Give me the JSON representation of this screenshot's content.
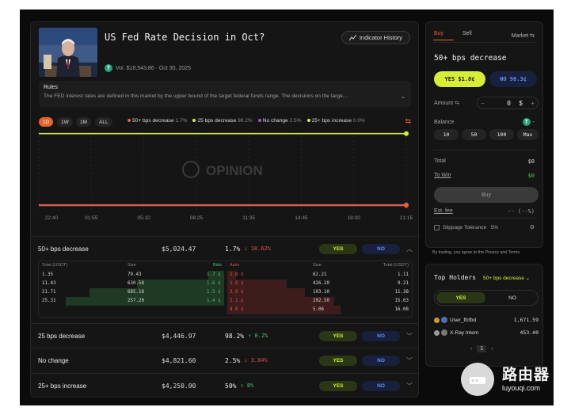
{
  "market": {
    "title": "US Fed Rate Decision in Oct?",
    "indicator_history_label": "Indicator History",
    "volume": "Vol. $18,543.86 · Oct 30, 2025",
    "rules_title": "Rules",
    "rules_text": "The FED interest rates are defined in this market by the upper bound of the target federal funds range. The decisions on the targe..."
  },
  "timeframes": [
    "1D",
    "1W",
    "1M",
    "ALL"
  ],
  "active_timeframe": "1D",
  "legend": [
    {
      "name": "50+ bps decrease",
      "pct": "1.7%",
      "color": "#e8622a"
    },
    {
      "name": "25 bps decrease",
      "pct": "98.2%",
      "color": "#d7ee36"
    },
    {
      "name": "No change",
      "pct": "2.5%",
      "color": "#9b59d0"
    },
    {
      "name": "25+ bps increase",
      "pct": "0.0%",
      "color": "#d7ee36"
    }
  ],
  "chart_data": {
    "type": "line",
    "x": [
      "22:40",
      "01:55",
      "05:10",
      "08:25",
      "11:35",
      "14:45",
      "18:00",
      "21:15"
    ],
    "series": [
      {
        "name": "25 bps decrease",
        "values": [
          98.2,
          98.2,
          98.2,
          98.2,
          98.2,
          98.2,
          98.2,
          98.2
        ],
        "color": "#d7ee36"
      },
      {
        "name": "No change",
        "values": [
          2.5,
          2.5,
          2.5,
          2.5,
          2.5,
          2.5,
          2.5,
          2.5
        ],
        "color": "#9b59d0"
      },
      {
        "name": "50+ bps decrease",
        "values": [
          1.7,
          1.7,
          1.7,
          1.7,
          1.7,
          1.7,
          1.7,
          1.7
        ],
        "color": "#e8622a"
      }
    ],
    "ylim": [
      0,
      100
    ],
    "watermark": "OPINION"
  },
  "outcomes": [
    {
      "name": "50+ bps decrease",
      "volume": "$5,024.47",
      "pct": "1.7%",
      "change": "↓ 18.62%",
      "dir": "down",
      "yes": "YES",
      "no": "NO",
      "chev": "︿"
    },
    {
      "name": "25 bps decrease",
      "volume": "$4,446.97",
      "pct": "98.2%",
      "change": "↑ 0.2%",
      "dir": "up",
      "yes": "YES",
      "no": "NO",
      "chev": "﹀"
    },
    {
      "name": "No change",
      "volume": "$4,821.60",
      "pct": "2.5%",
      "change": "↓ 3.84%",
      "dir": "down",
      "yes": "YES",
      "no": "NO",
      "chev": "﹀"
    },
    {
      "name": "25+ bps increase",
      "volume": "$4,250.00",
      "pct": "50%",
      "change": "↑ 8%",
      "dir": "up",
      "yes": "YES",
      "no": "NO",
      "chev": "﹀"
    }
  ],
  "orderbook": {
    "headers": {
      "total_l": "Total (USDT)",
      "size_l": "Size",
      "bids": "Bids",
      "asks": "Asks",
      "size_r": "Size",
      "total_r": "Total (USDT)"
    },
    "bids": [
      {
        "total": "1.35",
        "size": "79.43",
        "price": "1.7 ¢",
        "depth": 0.1
      },
      {
        "total": "11.43",
        "size": "630.58",
        "price": "1.6 ¢",
        "depth": 0.55
      },
      {
        "total": "21.71",
        "size": "685.18",
        "price": "1.5 ¢",
        "depth": 0.85
      },
      {
        "total": "25.31",
        "size": "257.20",
        "price": "1.4 ¢",
        "depth": 1.0
      }
    ],
    "asks": [
      {
        "price": "1.8 ¢",
        "size": "62.21",
        "total": "1.11",
        "depth": 0.07
      },
      {
        "price": "1.9 ¢",
        "size": "426.20",
        "total": "9.21",
        "depth": 0.5
      },
      {
        "price": "2.0 ¢",
        "size": "103.10",
        "total": "11.38",
        "depth": 0.65
      },
      {
        "price": "2.1 ¢",
        "size": "202.50",
        "total": "15.63",
        "depth": 0.9
      },
      {
        "price": "4.0 ¢",
        "size": "5.06",
        "total": "16.08",
        "depth": 0.95
      }
    ]
  },
  "trade": {
    "tab_buy": "Buy",
    "tab_sell": "Sell",
    "order_type": "Market",
    "selected_outcome": "50+ bps decrease",
    "yes_label": "YES $1.8¢",
    "no_label": "NO 98.3¢",
    "amount_label": "Amount",
    "amount_value": "0",
    "amount_unit": "$",
    "balance_label": "Balance",
    "balance_value": "-",
    "quick_amounts": [
      "10",
      "50",
      "100",
      "Max"
    ],
    "total_label": "Total",
    "total_value": "$0",
    "towin_label": "To Win",
    "towin_value": "$0",
    "buy_button": "Buy",
    "fee_label": "Est. fee",
    "fee_value": "-- (--%)",
    "slippage_label": "Slippage Tolerance",
    "slippage_value": "5%",
    "terms_text": "By trading, you agree to the Privacy and Terms."
  },
  "holders": {
    "title": "Top Holders",
    "outcome": "50+ bps decrease",
    "tab_yes": "YES",
    "tab_no": "NO",
    "list": [
      {
        "rank": "1",
        "name": "User_ffcfbd",
        "amount": "1,671.59"
      },
      {
        "rank": "2",
        "name": "X-Ray Intern",
        "amount": "453.40"
      }
    ],
    "page": "1"
  },
  "watermark": {
    "cn": "路由器",
    "url": "luyouqi.com"
  }
}
